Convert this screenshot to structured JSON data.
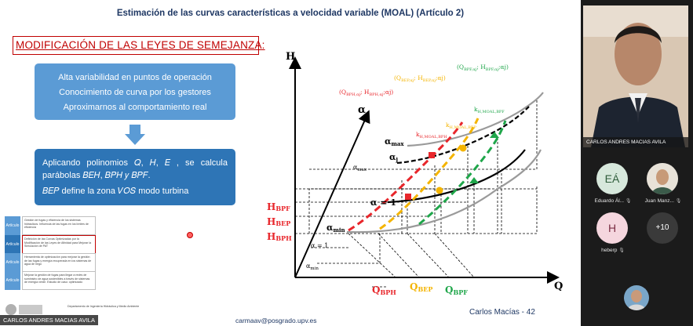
{
  "slide": {
    "title": "Estimación de las curvas características a velocidad variable (MOAL) (Artículo 2)",
    "section_title": "MODIFICACIÓN DE LAS LEYES DE SEMEJANZA:",
    "box1_lines": [
      "Alta variabilidad en puntos de operación",
      "Conocimiento de curva por los gestores",
      "Aproximarnos al comportamiento real"
    ],
    "box2_line1": "Aplicando polinomios 𝑄, 𝐻, 𝐸 , se calcula parábolas 𝐵𝐸𝐻, 𝐵𝑃𝐻 𝑦 𝐵𝑃𝐹.",
    "box2_line2": "𝐵𝐸𝑃 define la zona 𝑉𝑂𝑆 modo turbina",
    "agenda": [
      {
        "badge": "Artículo 1",
        "text": "Gestión de fugas y eficiencia de los sistemas hidráulicos. Influencia de las fugas en los límites de eficiencia",
        "active": false
      },
      {
        "badge": "Artículo 2",
        "text": "Definición de las Curvas Optimizadas por la Modificación de las Leyes de Afinidad para Mejorar la Simulación de PAT",
        "active": true
      },
      {
        "badge": "Artículo 3",
        "text": "Herramienta de optimización para mejorar la gestión de las fugas y energía recuperada en los sistemas de agua de riego",
        "active": false
      },
      {
        "badge": "Artículo 4",
        "text": "Mejorar la gestión de fugas para llegar a redes de suministro de agua sostenibles a través de sistemas de energía verde. Estudio de caso: optimizado",
        "active": false
      }
    ],
    "footer_email": "carmaav@posgrado.upv.es",
    "footer_author": "Carlos Macías - 42",
    "dept_text": "Departamento de Ingeniería Hidráulica y Medio Ambiente",
    "speaker_caption": "CARLOS ANDRES MACIAS AVILA"
  },
  "diagram": {
    "axis_h": "H",
    "axis_q": "Q",
    "axis_alpha": "α",
    "labels": {
      "bph_coord": "(Q",
      "bph_sub": "BPH,αj",
      "bph_mid": "; H",
      "bph_sub2": "BPH,αj",
      "bph_end": ";αj)",
      "bep_coord": "(Q",
      "bep_sub": "BEP,αj",
      "bep_mid": "; H",
      "bep_sub2": "BEP,αj",
      "bep_end": ";αj)",
      "bpf_coord": "(Q",
      "bpf_sub": "BPF,αj",
      "bpf_mid": "; H",
      "bpf_sub2": "BPF,αj",
      "bpf_end": ";αj)",
      "k_bph": "k",
      "k_bph_sub": "H,MOAL,BPH",
      "k_bep": "k",
      "k_bep_sub": "H,MOAL,BEP",
      "k_bpf": "k",
      "k_bpf_sub": "H,MOAL,BPF",
      "alpha_max": "α",
      "alpha_max_sub": "max",
      "alpha_j": "α",
      "alpha_j_sub": "j",
      "alpha_one": "α = 1",
      "alpha_min": "α",
      "alpha_min_sub": "min",
      "h_bpf": "H",
      "h_bpf_sub": "BPF",
      "h_bep": "H",
      "h_bep_sub": "BEP",
      "h_bph": "H",
      "h_bph_sub": "BPH",
      "q_bph": "Q",
      "q_bph_sub": "BPH",
      "q_bep": "Q",
      "q_bep_sub": "BEP",
      "q_bpf": "Q",
      "q_bpf_sub": "BPF",
      "ax_alpha_max": "α",
      "ax_alpha_max_sub": "max",
      "ax_alpha_one": "α = 1",
      "ax_alpha_min": "α",
      "ax_alpha_min_sub": "min"
    },
    "colors": {
      "bph": "#e8262b",
      "bep": "#f4b400",
      "bpf": "#1fa64a",
      "ink": "#000000"
    }
  },
  "participants": {
    "main_name": "CARLOS ANDRES MACIAS AVILA",
    "tiles": [
      {
        "initials": "EÁ",
        "name": "Eduardo Ál...",
        "bg": "#d7e8dc",
        "fg": "#2e5c3a"
      },
      {
        "initials": "",
        "name": "Juan Manz...",
        "bg": "#6b6f74",
        "fg": "#ffffff"
      },
      {
        "initials": "H",
        "name": "heberp",
        "bg": "#f5d6de",
        "fg": "#7a2d44"
      },
      {
        "initials": "+10",
        "name": "",
        "bg": "#3a3a3a",
        "fg": "#ffffff"
      }
    ]
  }
}
